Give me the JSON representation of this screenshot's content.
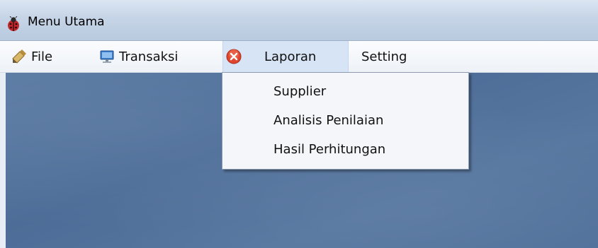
{
  "window": {
    "title": "Menu Utama",
    "icon": "ladybug-app-icon"
  },
  "menubar": {
    "items": [
      {
        "label": "File",
        "icon": "pencil-book-icon"
      },
      {
        "label": "Transaksi",
        "icon": "monitor-icon"
      },
      {
        "label": "Laporan",
        "icon": "red-x-circle-icon",
        "active": true
      },
      {
        "label": "Setting"
      }
    ]
  },
  "dropdown": {
    "items": [
      {
        "label": "Supplier"
      },
      {
        "label": "Analisis Penilaian"
      },
      {
        "label": "Hasil Perhitungan"
      }
    ]
  },
  "colors": {
    "workspace": "#4f6f99",
    "menu_active": "#d6e4f5",
    "titlebar": "#c5d4e6"
  }
}
